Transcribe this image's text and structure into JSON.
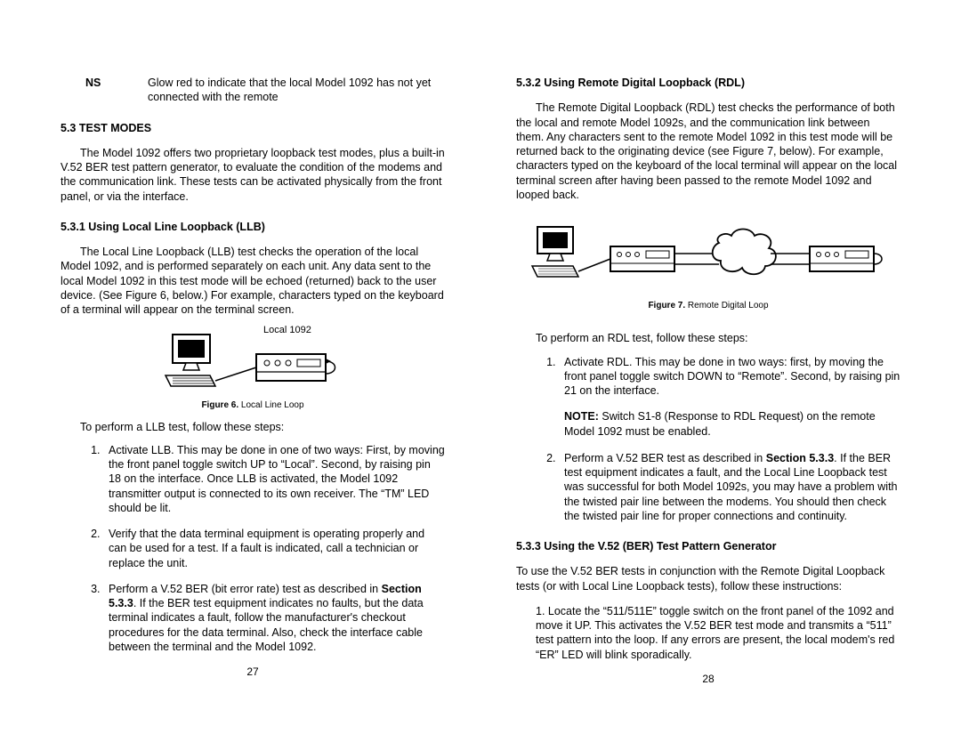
{
  "left": {
    "ns_label": "NS",
    "ns_text": "Glow red to indicate that the local Model 1092 has not yet connected with the remote",
    "sec53": "5.3 TEST MODES",
    "p53": "The Model 1092 offers two proprietary loopback test modes, plus a built-in V.52 BER test pattern generator, to evaluate the condition of the modems and the communication link.  These tests can be activated physically from the front panel, or via the interface.",
    "sec531": "5.3.1  Using Local Line Loopback (LLB)",
    "p531": "The Local Line Loopback (LLB) test checks the operation of the local Model 1092, and is performed separately on each unit.  Any data sent to the local Model 1092 in this test mode will be echoed (returned) back to the user device. (See Figure 6, below.)  For example, characters typed on the keyboard of a terminal will appear on the terminal screen.",
    "fig6_label": "Local 1092",
    "fig6_bold": "Figure 6.",
    "fig6_rest": "  Local Line Loop",
    "steps_intro": "To perform a LLB test, follow these steps:",
    "steps": [
      "Activate LLB.  This may be done in one of two ways:  First, by moving the front panel toggle switch UP to “Local”.  Second, by raising pin 18 on the interface.  Once LLB is activated, the Model 1092 transmitter output is connected to its own receiver.  The “TM” LED should be lit.",
      "Verify that the data terminal equipment is operating properly and can be used for a test.  If a fault is indicated, call a technician or replace the unit."
    ],
    "step3_a": "Perform a V.52 BER (bit error rate) test as described in ",
    "step3_b": "Section 5.3.3",
    "step3_c": ". If the BER test equipment indicates no faults, but the data terminal indicates a fault, follow the manufacturer's checkout procedures for the data terminal.  Also, check the interface cable between the terminal and the Model 1092.",
    "pagenum": "27"
  },
  "right": {
    "sec532": "5.3.2  Using Remote Digital Loopback (RDL)",
    "p532": "The Remote Digital Loopback (RDL) test checks the performance of both the local and remote Model 1092s, and the communication link between them.  Any characters sent to the remote Model 1092 in this test mode will be returned back to the originating device (see Figure 7, below).  For example, characters typed on the keyboard of the local terminal will appear on the local terminal screen after having been passed to the remote Model 1092 and looped back.",
    "fig7_bold": "Figure 7.",
    "fig7_rest": "  Remote Digital Loop",
    "steps_intro": "To perform an RDL test, follow these steps:",
    "step1": "Activate RDL.  This may be done in two ways:  first, by moving the front panel toggle switch DOWN to “Remote”.  Second, by raising pin 21 on the interface.",
    "note_b": "NOTE:",
    "note_rest": "  Switch S1-8 (Response to RDL Request) on the remote Model 1092 must be enabled.",
    "step2_a": "Perform a V.52 BER test as described in ",
    "step2_b": "Section 5.3.3",
    "step2_c": ".  If the BER test equipment indicates a fault, and the Local Line Loopback test was successful for both Model 1092s, you may have a problem with the twisted pair line between the modems.  You should then check the twisted pair line for proper connections and continuity.",
    "sec533": "5.3.3  Using the V.52 (BER) Test Pattern Generator",
    "p533": "To use the V.52 BER tests in conjunction with the Remote Digital Loopback tests (or with Local Line Loopback tests), follow these instructions:",
    "p533_1": "1. Locate the “511/511E” toggle switch on the front panel of the 1092 and move it UP.  This activates the V.52 BER test mode and transmits a “511” test pattern into the loop.  If any errors are present, the local modem's red “ER” LED will blink sporadically.",
    "pagenum": "28"
  }
}
